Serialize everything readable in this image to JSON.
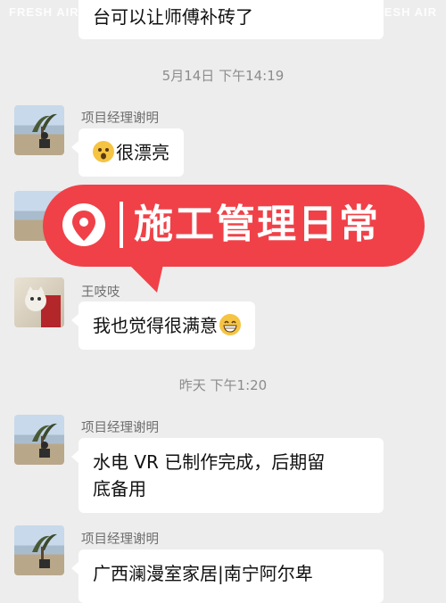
{
  "watermark": {
    "left": "FRESH AIR",
    "right": "FRESH AIR"
  },
  "messages": {
    "top_partial": "台可以让师傅补砖了",
    "time1": "5月14日 下午14:19",
    "sender1": "项目经理谢明",
    "msg1": "很漂亮",
    "sender2": "王吱吱",
    "msg2": "我也觉得很满意",
    "time2": "昨天 下午1:20",
    "sender3": "项目经理谢明",
    "msg3_line1": "水电 VR 已制作完成，后期留",
    "msg3_line2": "底备用",
    "sender4": "项目经理谢明",
    "msg4_partial": "广西澜漫室家居|南宁阿尔卑"
  },
  "banner": {
    "title": "施工管理日常",
    "color": "#f04148"
  },
  "icons": {
    "msg1_emoji": "astonished-face-emoji",
    "msg2_emoji": "grinning-face-emoji",
    "banner_icon": "location-pin-icon"
  },
  "colors": {
    "background": "#ededed",
    "bubble": "#ffffff",
    "banner": "#f04148"
  }
}
